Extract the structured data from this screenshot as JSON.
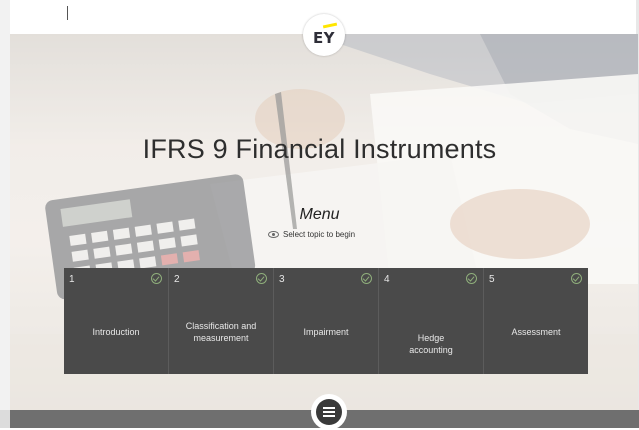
{
  "brand": {
    "logo_text": "EY",
    "logo_accent": "#ffe600"
  },
  "course": {
    "title": "IFRS 9 Financial Instruments",
    "menu_title": "Menu",
    "menu_hint": "Select topic to begin"
  },
  "topics": [
    {
      "number": "1",
      "label": "Introduction",
      "completed": true
    },
    {
      "number": "2",
      "label": "Classification and measurement",
      "completed": true
    },
    {
      "number": "3",
      "label": "Impairment",
      "completed": true
    },
    {
      "number": "4",
      "label": "Hedge accounting",
      "completed": true
    },
    {
      "number": "5",
      "label": "Assessment",
      "completed": true
    }
  ],
  "colors": {
    "tile_bg": "#4a4a4a",
    "check": "#8fae7b",
    "bottom_bar": "#6f6f6f"
  },
  "icons": {
    "menu_button": "hamburger-menu-icon",
    "hint_icon": "eye-icon",
    "topic_status": "check-circle-icon"
  }
}
